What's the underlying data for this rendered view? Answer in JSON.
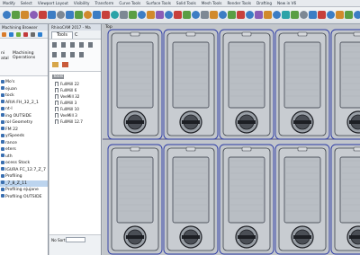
{
  "menu_tabs": [
    "Modify",
    "Select",
    "Viewport Layout",
    "Visibility",
    "Transform",
    "Curve Tools",
    "Surface Tools",
    "Solid Tools",
    "Mesh Tools",
    "Render Tools",
    "Drafting",
    "New in V6"
  ],
  "left_panel": {
    "title": "Machining Browser",
    "labels": {
      "a": "ni",
      "b": "Machining",
      "c": "Operations",
      "d": "atal"
    },
    "items": [
      {
        "label": "Mo's"
      },
      {
        "label": "ejuan"
      },
      {
        "label": "tock"
      },
      {
        "label": "ARIA FH_32_2_1"
      },
      {
        "label": "nt-l"
      },
      {
        "label": "ing OUTSIDE"
      },
      {
        "label": "rol Geometry"
      },
      {
        "label": "FM 22"
      },
      {
        "label": "y/Speeds"
      },
      {
        "label": "rance"
      },
      {
        "label": "eters"
      },
      {
        "label": "uth"
      },
      {
        "label": "ocess Stock"
      },
      {
        "label": "IGURA FC_12.7_Z_7"
      },
      {
        "label": "Profiling"
      },
      {
        "label": "_7_8_Z_11"
      },
      {
        "label": "Profiling ejujane"
      },
      {
        "label": "Profiling OUTSIDE"
      }
    ]
  },
  "mid_panel": {
    "title": "RhinoCAM 2017 - Ma",
    "tab_tools": "Tools",
    "tab_other": "C",
    "root_label": "Tools",
    "tools": [
      {
        "label": "FullMill 22"
      },
      {
        "label": "FullMill 6"
      },
      {
        "label": "VeeMill 32"
      },
      {
        "label": "FullMill 3"
      },
      {
        "label": "FullMill 10"
      },
      {
        "label": "VeeMill 3"
      },
      {
        "label": "FullMill 12.7"
      }
    ],
    "sort_label": "No Sort"
  },
  "viewport": {
    "label": "Top",
    "part_count_rows": 2,
    "part_count_cols": 5
  }
}
